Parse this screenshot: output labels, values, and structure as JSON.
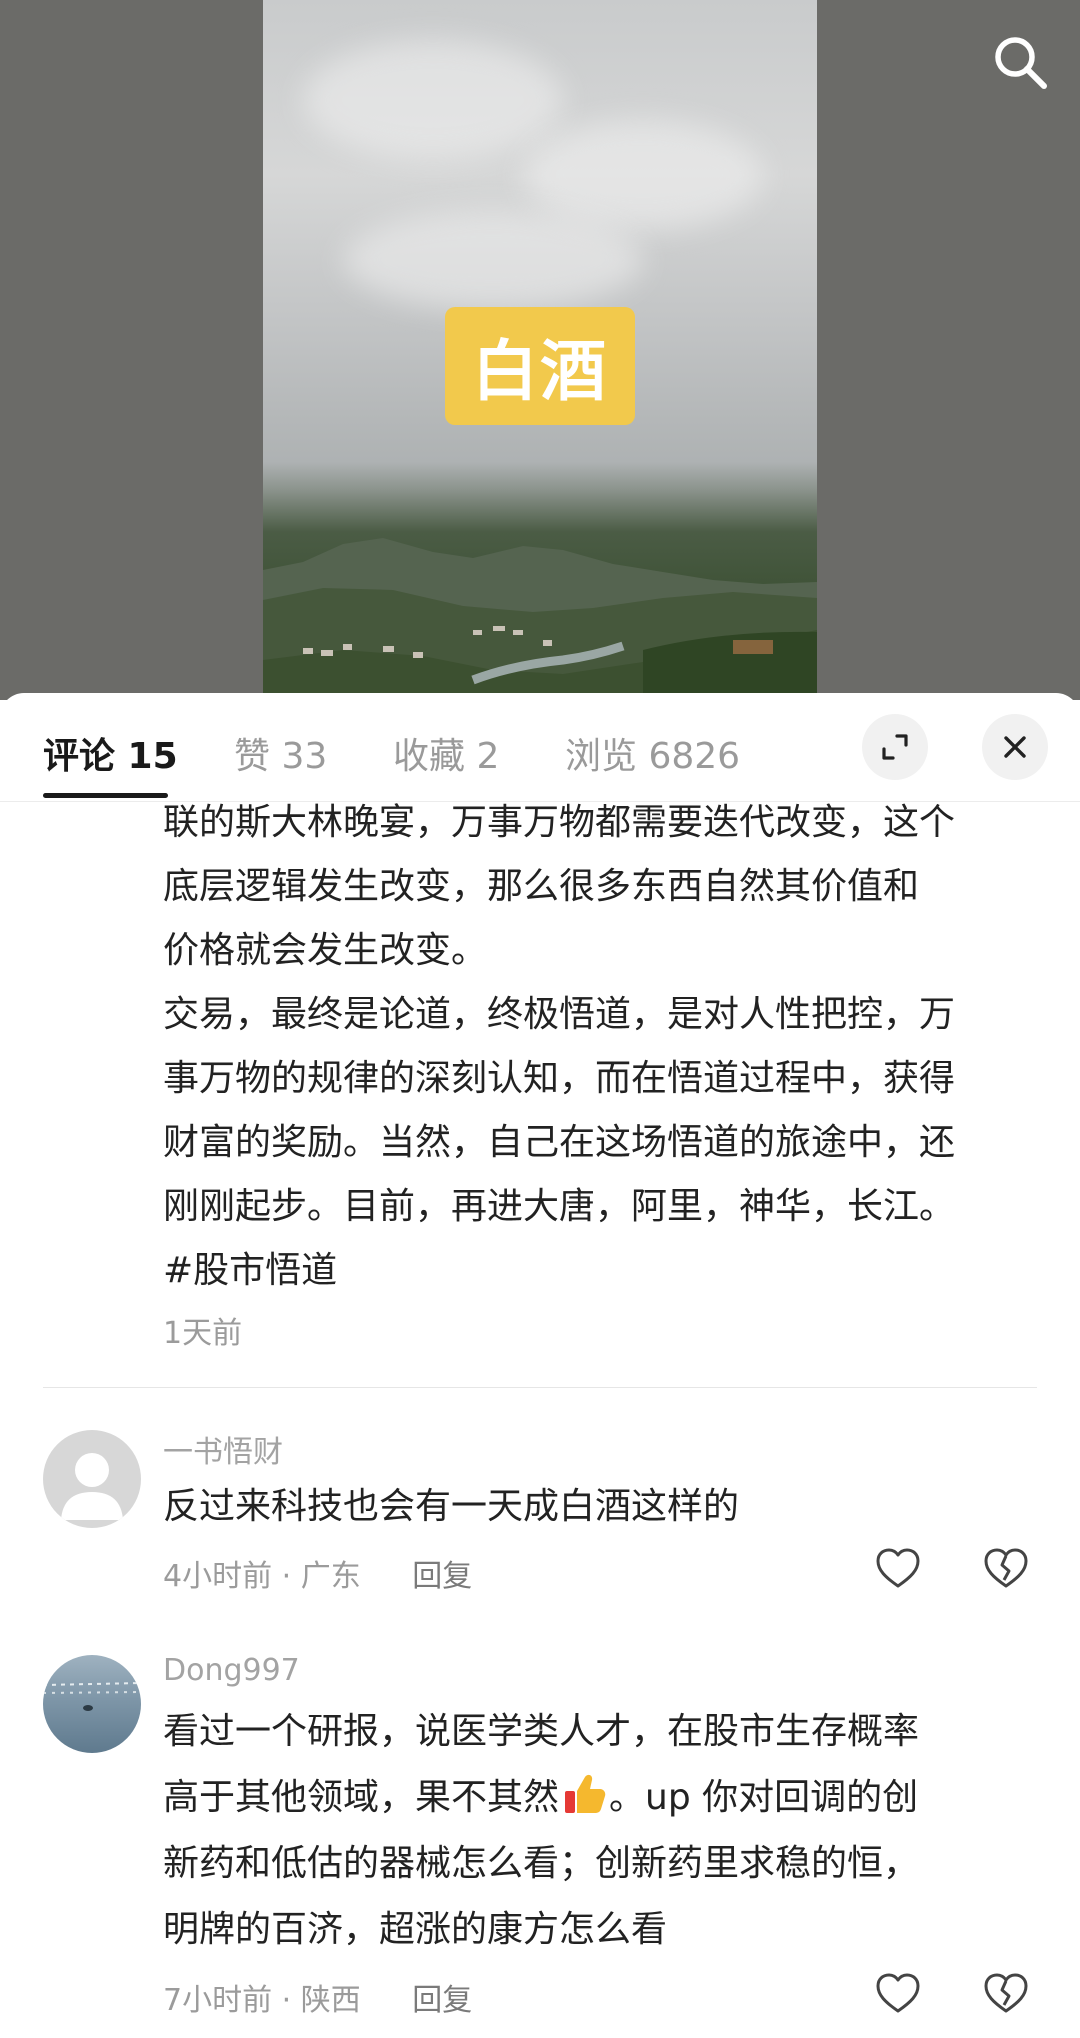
{
  "media": {
    "sticker_text": "白酒",
    "search_icon": "search-icon"
  },
  "tabs": [
    {
      "label": "评论 15",
      "active": true
    },
    {
      "label": "赞 33"
    },
    {
      "label": "收藏 2"
    },
    {
      "label": "浏览 6826"
    }
  ],
  "header_buttons": {
    "expand_icon": "expand-icon",
    "close_icon": "close-icon"
  },
  "post": {
    "lines": [
      "联的斯大林晚宴，万事万物都需要迭代改变，这个",
      "底层逻辑发生改变，那么很多东西自然其价值和",
      "价格就会发生改变。",
      "交易，最终是论道，终极悟道，是对人性把控，万",
      "事万物的规律的深刻认知，而在悟道过程中，获得",
      "财富的奖励。当然，自己在这场悟道的旅途中，还",
      "刚刚起步。目前，再进大唐，阿里，神华，长江。",
      "#股市悟道"
    ],
    "time": "1天前"
  },
  "comments": [
    {
      "username": "一书悟财",
      "lines": [
        "反过来科技也会有一天成白酒这样的"
      ],
      "time": "4小时前",
      "location": "广东",
      "reply_label": "回复"
    },
    {
      "username": "Dong997",
      "line1": "看过一个研报，说医学类人才，在股市生存概率",
      "line2_before": "高于其他领域，果不其然",
      "line2_after": "。up 你对回调的创",
      "line3": "新药和低估的器械怎么看；创新药里求稳的恒，",
      "line4": "明牌的百济，超涨的康方怎么看",
      "time": "7小时前",
      "location": "陕西",
      "reply_label": "回复"
    }
  ],
  "icons": {
    "like": "heart-icon",
    "dislike": "broken-heart-icon",
    "thumbs_up": "thumbs-up-emoji"
  },
  "colors": {
    "sticker_bg": "#f2c94c",
    "tab_active": "#1a1a1a",
    "tab_inactive": "#9a9a9a"
  }
}
